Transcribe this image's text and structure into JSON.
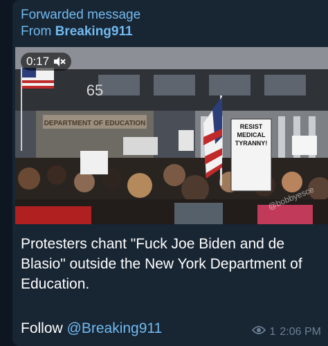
{
  "message": {
    "forwarded_label": "Forwarded message",
    "from_prefix": "From",
    "from_name": "Breaking911",
    "video": {
      "duration": "0:17",
      "sound_icon": "muted-speaker-icon",
      "scene_texts": {
        "building_number": "65",
        "building_sign": "DEPARTMENT OF EDUCATION",
        "protest_sign": [
          "RESIST",
          "MEDICAL",
          "TYRANNY!"
        ],
        "watermark": "@bobbyesce"
      }
    },
    "caption": "Protesters chant \"Fuck Joe Biden and de Blasio\" outside the New York Department of Education.",
    "follow_prefix": "Follow",
    "follow_mention": "@Breaking911",
    "views_icon": "eye-icon",
    "views": "1",
    "time": "2:06 PM"
  },
  "colors": {
    "background": "#0e1621",
    "bubble": "#182533",
    "accent": "#71baf0",
    "meta": "#6d8094"
  }
}
